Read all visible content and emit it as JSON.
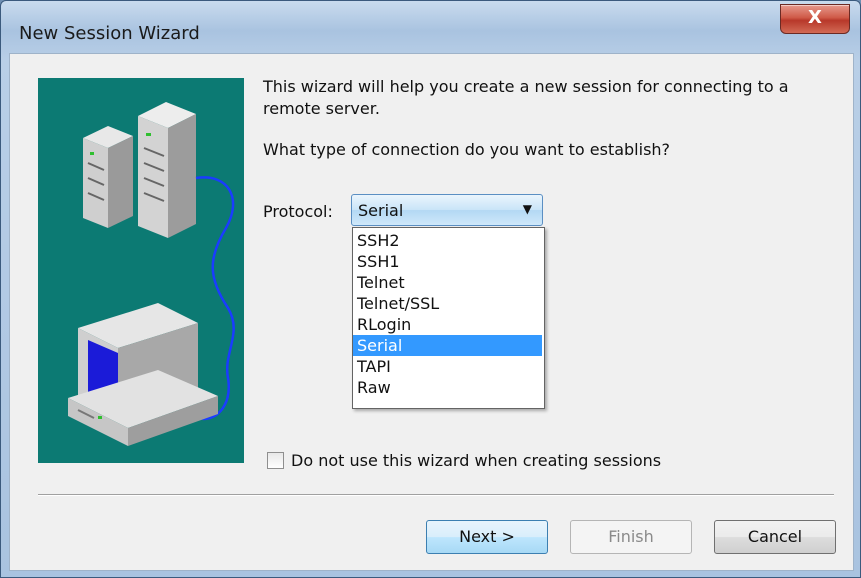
{
  "window": {
    "title": "New Session Wizard",
    "close_label": "X"
  },
  "wizard": {
    "intro_text": "This wizard will help you create a new session for connecting to a remote server.",
    "question_text": "What type of connection do you want to establish?",
    "protocol_label": "Protocol:",
    "protocol_selected": "Serial",
    "protocol_options": [
      "SSH2",
      "SSH1",
      "Telnet",
      "Telnet/SSL",
      "RLogin",
      "Serial",
      "TAPI",
      "Raw"
    ],
    "checkbox_label": "Do not use this wizard when creating sessions",
    "checkbox_checked": false
  },
  "buttons": {
    "next": "Next >",
    "finish": "Finish",
    "cancel": "Cancel",
    "finish_enabled": false
  },
  "icons": {
    "dropdown": "chevron-down-icon",
    "illustration": "server-to-computer-illustration"
  },
  "colors": {
    "illustration_bg": "#0c7a73",
    "selection": "#3399ff",
    "close_button": "#c9483a"
  }
}
